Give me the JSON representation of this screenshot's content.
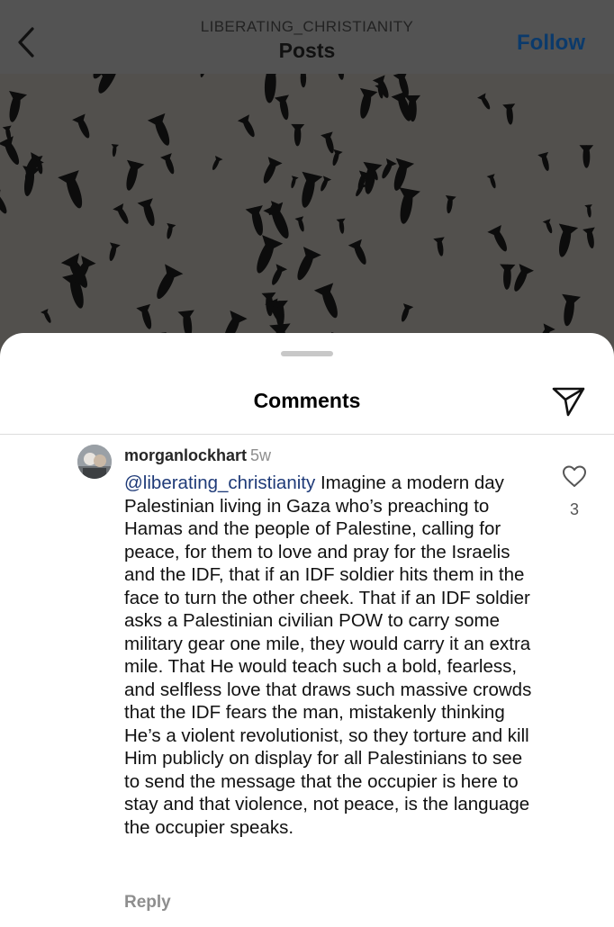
{
  "header": {
    "account_name": "LIBERATING_CHRISTIANITY",
    "title": "Posts",
    "follow_label": "Follow"
  },
  "comments_sheet": {
    "title": "Comments"
  },
  "comment": {
    "username": "morganlockhart",
    "timestamp": "5w",
    "mention": "@liberating_christianity",
    "text": " Imagine a modern day Palestinian living in Gaza who’s preaching to Hamas and the people of Palestine, calling for peace, for them to love and pray for the Israelis and the IDF, that if an IDF soldier hits them in the face to turn the other cheek. That if an IDF soldier asks a Palestinian civilian POW to carry some military gear one mile, they would carry it an extra mile. That He would teach such a bold, fearless, and selfless love that draws such massive crowds that the IDF fears the man, mistakenly thinking He’s a violent revolutionist, so they torture and kill Him publicly on display for all Palestinians to see to send the message that the occupier is here to stay and that violence, not peace, is the language the occupier speaks.",
    "like_count": "3",
    "reply_label": "Reply"
  },
  "icons": [
    "back-chevron-icon",
    "share-paper-plane-icon",
    "heart-outline-icon"
  ],
  "colors": {
    "follow": "#0b3a6b",
    "mention": "#1e3a78",
    "muted": "#8e8e8e"
  }
}
